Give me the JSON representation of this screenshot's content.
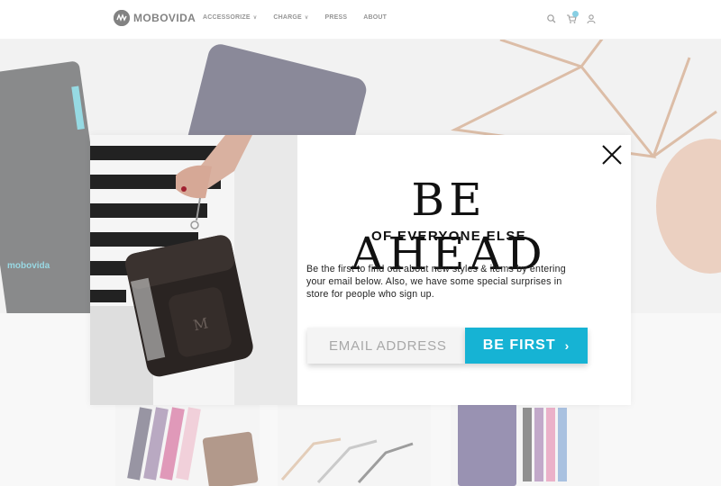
{
  "header": {
    "logo_text": "MOBOVIDA",
    "nav": [
      {
        "label": "ACCESSORIZE",
        "has_dropdown": true
      },
      {
        "label": "CHARGE",
        "has_dropdown": true
      },
      {
        "label": "PRESS",
        "has_dropdown": false
      },
      {
        "label": "ABOUT",
        "has_dropdown": false
      }
    ],
    "icons": [
      "search-icon",
      "cart-icon",
      "user-icon"
    ]
  },
  "hero": {
    "product_label": "mobovida"
  },
  "popup": {
    "headline": "BE AHEAD",
    "subheadline": "OF EVERYONE ELSE",
    "body": "Be the first to find out about new styles & items by entering your email below. Also, we have some special surprises in store for people who sign up.",
    "email_placeholder": "EMAIL ADDRESS",
    "email_value": "",
    "submit_label": "BE FIRST",
    "close_icon": "close-icon"
  },
  "colors": {
    "accent": "#16b3d4",
    "text": "#111111",
    "overlay": "rgba(255,255,255,0.48)"
  }
}
